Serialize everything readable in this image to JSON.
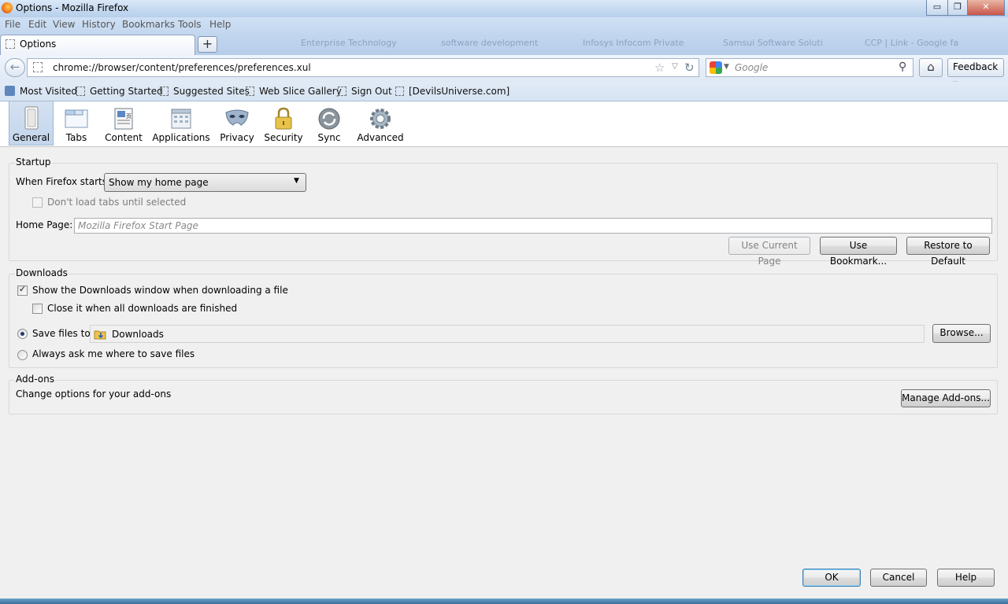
{
  "window": {
    "title": "Options - Mozilla Firefox",
    "minimize_glyph": "▭",
    "restore_glyph": "❐",
    "close_glyph": "✕"
  },
  "menubar": {
    "items": [
      "File",
      "Edit",
      "View",
      "History",
      "Bookmarks",
      "Tools",
      "Help"
    ]
  },
  "tabs": {
    "active_label": "Options",
    "new_tab_glyph": "+",
    "background_tabs": [
      "Enterprise Technology",
      "software development",
      "Infosys Infocom Private",
      "Samsui Software Soluti",
      "CCP | Link - Google fa"
    ]
  },
  "navbar": {
    "back_glyph": "←",
    "url": "chrome://browser/content/preferences/preferences.xul",
    "star_glyph": "☆",
    "dropdown_glyph": "▽",
    "reload_glyph": "↻",
    "search_placeholder": "Google",
    "search_drop_glyph": "▼",
    "search_go_glyph": "⚲",
    "home_glyph": "⌂",
    "feedback_label": "Feedback ▾"
  },
  "bookmarks": {
    "items": [
      "Most Visited",
      "Getting Started",
      "Suggested Sites",
      "Web Slice Gallery",
      "Sign Out",
      "[DevilsUniverse.com]"
    ]
  },
  "panes": {
    "items": [
      "General",
      "Tabs",
      "Content",
      "Applications",
      "Privacy",
      "Security",
      "Sync",
      "Advanced"
    ],
    "selected": "General"
  },
  "startup": {
    "caption": "Startup",
    "when_label": "When Firefox starts:",
    "when_value": "Show my home page",
    "dont_load_label": "Don't load tabs until selected",
    "home_page_label": "Home Page:",
    "home_page_placeholder": "Mozilla Firefox Start Page",
    "use_current_label": "Use Current Page",
    "use_bookmark_label": "Use Bookmark...",
    "restore_label": "Restore to Default"
  },
  "downloads": {
    "caption": "Downloads",
    "show_window_label": "Show the Downloads window when downloading a file",
    "show_window_checked": true,
    "close_when_done_label": "Close it when all downloads are finished",
    "close_when_done_checked": false,
    "save_to_label": "Save files to",
    "save_folder": "Downloads",
    "browse_label": "Browse...",
    "always_ask_label": "Always ask me where to save files"
  },
  "addons": {
    "caption": "Add-ons",
    "description": "Change options for your add-ons",
    "manage_label": "Manage Add-ons..."
  },
  "dialog": {
    "ok_label": "OK",
    "cancel_label": "Cancel",
    "help_label": "Help"
  }
}
